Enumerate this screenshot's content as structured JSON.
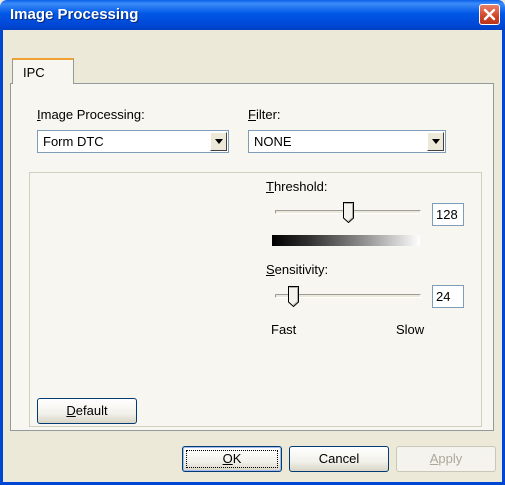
{
  "window": {
    "title": "Image Processing"
  },
  "tabs": [
    {
      "label": "IPC"
    }
  ],
  "image_processing": {
    "label_prefix": "",
    "label_accel": "I",
    "label_rest": "mage Processing:",
    "value": "Form DTC"
  },
  "filter": {
    "label_accel": "F",
    "label_rest": "ilter:",
    "value": "NONE"
  },
  "threshold": {
    "label_accel": "T",
    "label_rest": "hreshold:",
    "value": "128",
    "level": 128,
    "min": 0,
    "max": 255
  },
  "sensitivity": {
    "label_accel": "S",
    "label_rest": "ensitivity:",
    "value": "24",
    "level": 24,
    "min": 0,
    "max": 255,
    "left_label": "Fast",
    "right_label": "Slow"
  },
  "buttons": {
    "default": {
      "accel": "D",
      "pre": "",
      "post": "efault"
    },
    "ok": {
      "accel": "O",
      "post": "K"
    },
    "cancel": {
      "label": "Cancel"
    },
    "apply": {
      "accel": "A",
      "post": "pply"
    }
  }
}
